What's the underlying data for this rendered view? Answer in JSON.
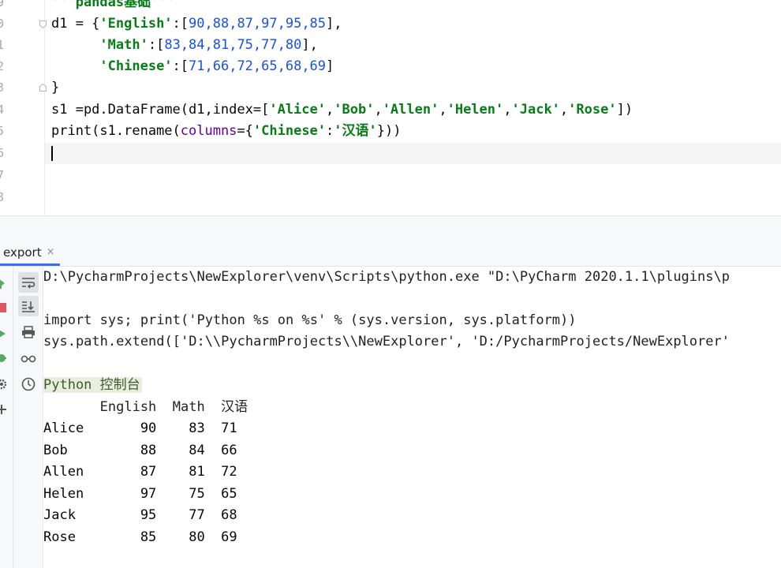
{
  "editor": {
    "line_numbers": [
      "9",
      "0",
      "1",
      "2",
      "3",
      "4",
      "5",
      "6",
      "7",
      "8"
    ],
    "docstring_fragment": "'''pandas基础'''",
    "code": {
      "d1_open": "d1 = {",
      "english_key": "'English'",
      "math_key": "'Math'",
      "chinese_key": "'Chinese'",
      "english_vals": "90,88,87,97,95,85",
      "math_vals": "83,84,81,75,77,80",
      "chinese_vals": "71,66,72,65,68,69",
      "close_brace": "}",
      "s1_line_prefix": "s1 =pd.DataFrame(d1,index=[",
      "index_names": [
        "'Alice'",
        "'Bob'",
        "'Allen'",
        "'Helen'",
        "'Jack'",
        "'Rose'"
      ],
      "s1_line_suffix": "])",
      "print_prefix": "print(s1.rename(",
      "columns_kw": "columns",
      "print_mid": "={",
      "rename_from": "'Chinese'",
      "colon": ":",
      "rename_to": "'汉语'",
      "print_suffix": "}))"
    }
  },
  "run_panel": {
    "tab_label": "export",
    "tab_close": "×"
  },
  "console": {
    "cmd_line": "D:\\PycharmProjects\\NewExplorer\\venv\\Scripts\\python.exe \"D:\\PyCharm 2020.1.1\\plugins\\p",
    "import_line": "import sys; print('Python %s on %s' % (sys.version, sys.platform))",
    "path_line": "sys.path.extend(['D:\\\\PycharmProjects\\\\NewExplorer', 'D:/PycharmProjects/NewExplorer'",
    "banner": "Python 控制台",
    "header": "       English  Math  汉语",
    "rows": [
      "Alice       90    83  71",
      "Bob         88    84  66",
      "Allen       87    81  72",
      "Helen       97    75  65",
      "Jack        95    77  68",
      "Rose        85    80  69"
    ]
  },
  "icons": {
    "soft_wrap": "soft-wrap-icon",
    "scroll_end": "scroll-to-end-icon",
    "print": "print-icon",
    "glasses": "view-mode-icon",
    "history": "history-icon"
  },
  "colors": {
    "string_green": "#067d17",
    "number_blue": "#1750eb",
    "keyword_purple": "#660099",
    "banner_bg": "#e9eedf"
  }
}
